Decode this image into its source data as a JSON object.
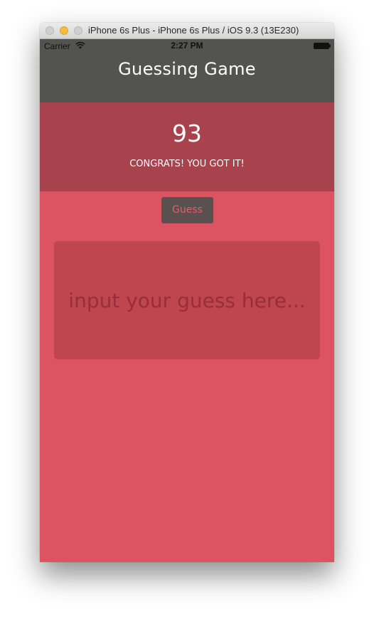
{
  "window": {
    "title": "iPhone 6s Plus - iPhone 6s Plus / iOS 9.3 (13E230)"
  },
  "status_bar": {
    "carrier": "Carrier",
    "time": "2:27 PM",
    "wifi_icon": "wifi-icon",
    "battery_icon": "battery-icon"
  },
  "app": {
    "title": "Guessing Game"
  },
  "result": {
    "number": "93",
    "message": "CONGRATS! YOU GOT IT!"
  },
  "controls": {
    "guess_button_label": "Guess"
  },
  "input": {
    "value": "",
    "placeholder": "input your guess here..."
  },
  "colors": {
    "header_background": "#53534f",
    "result_background": "#a8434d",
    "screen_background": "#db5460",
    "input_background": "#bf454f",
    "button_background": "#59504f",
    "button_text": "#e05f6a"
  }
}
